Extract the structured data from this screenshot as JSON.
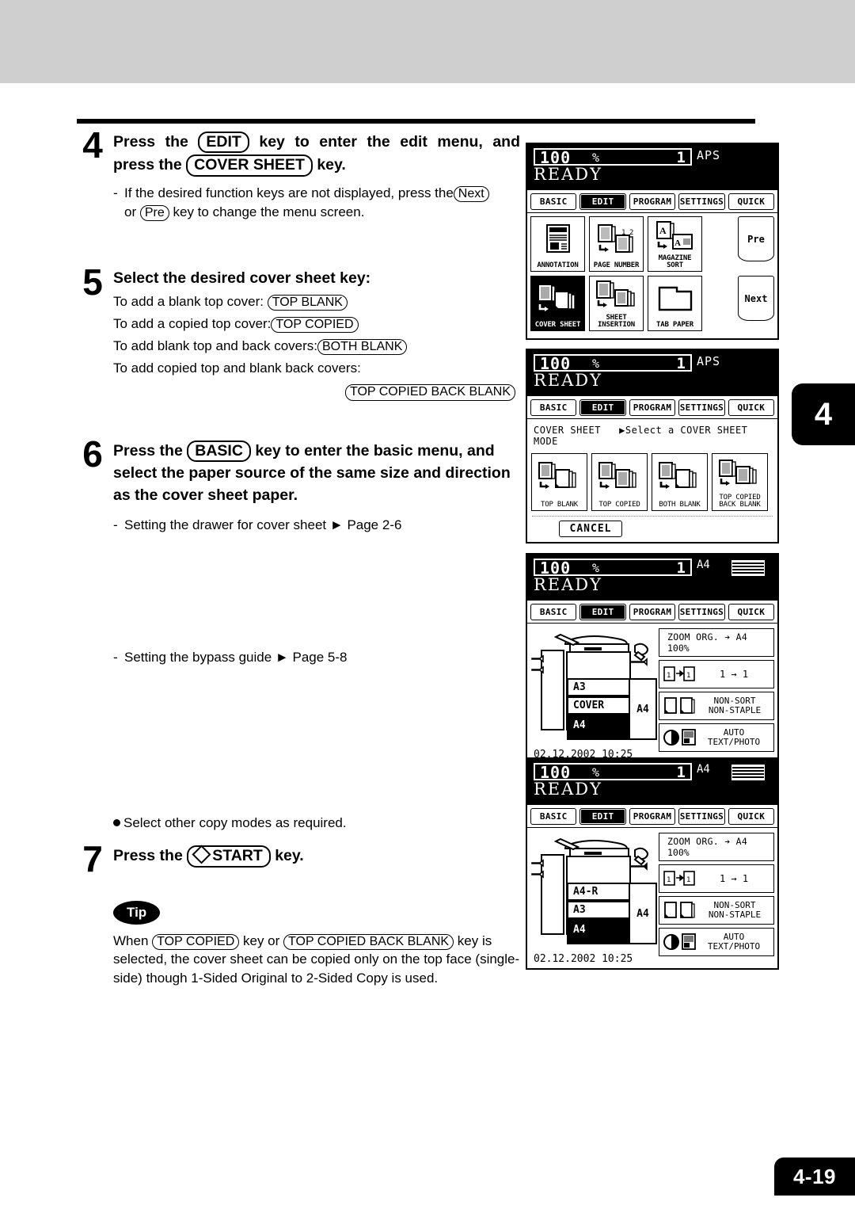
{
  "page": {
    "chapter_tab": "4",
    "page_number": "4-19"
  },
  "steps": {
    "step4": {
      "num": "4",
      "head_line1_a": "Press the",
      "head_key1": "EDIT",
      "head_line1_b": "key to enter the edit menu, and",
      "head_line2_a": "press the",
      "head_key2": "COVER SHEET",
      "head_line2_b": "key.",
      "sub_a": "If the desired function keys are not displayed, press the",
      "sub_key_next": "Next",
      "sub_b": "or",
      "sub_key_pre": "Pre",
      "sub_c": "key to change the menu screen."
    },
    "step5": {
      "num": "5",
      "head": "Select the desired cover sheet key:",
      "lines": [
        {
          "text": "To add a blank top cover:",
          "key": "TOP BLANK"
        },
        {
          "text": "To add a copied top cover:",
          "key": "TOP COPIED"
        },
        {
          "text": "To add blank top and back covers:",
          "key": "BOTH BLANK"
        },
        {
          "text": "To add copied top and blank back covers:",
          "key": ""
        }
      ],
      "last_key": "TOP COPIED BACK BLANK"
    },
    "step6": {
      "num": "6",
      "head_a": "Press the",
      "head_key": "BASIC",
      "head_b": "key to enter the basic menu, and",
      "head_line2": "select the paper source of the same size and direction",
      "head_line3": "as the cover sheet paper.",
      "sub1": "Setting the drawer for cover sheet",
      "sub1_ref": "Page 2-6",
      "sub2": "Setting the bypass guide",
      "sub2_ref": "Page 5-8"
    },
    "note_bullet": "Select other copy modes as required.",
    "step7": {
      "num": "7",
      "head_a": "Press the",
      "head_key": "START",
      "head_b": "key."
    },
    "tip": {
      "badge": "Tip",
      "t1": "When",
      "key1": "TOP COPIED",
      "t2": "key or",
      "key2": "TOP COPIED BACK BLANK",
      "t3": "key  is selected, the cover sheet can be copied only on the top face (single-side) though 1-Sided Original to 2-Sided Copy is used."
    }
  },
  "lcd_common": {
    "zoom": "100",
    "percent": "%",
    "copies": "1",
    "ready": "READY",
    "tabs": [
      "BASIC",
      "EDIT",
      "PROGRAM",
      "SETTINGS",
      "QUICK"
    ],
    "selected_tab": "EDIT"
  },
  "lcd1": {
    "status_right": "APS",
    "row1": [
      {
        "label": "ANNOTATION",
        "icon": "annotation-icon",
        "selected": false
      },
      {
        "label": "PAGE NUMBER",
        "icon": "page-number-icon",
        "selected": false
      },
      {
        "label": "MAGAZINE SORT",
        "icon": "magazine-sort-icon",
        "selected": false
      }
    ],
    "row2": [
      {
        "label": "COVER SHEET",
        "icon": "cover-sheet-icon",
        "selected": true
      },
      {
        "label": "SHEET INSERTION",
        "icon": "sheet-insertion-icon",
        "selected": false
      },
      {
        "label": "TAB PAPER",
        "icon": "tab-paper-icon",
        "selected": false
      }
    ],
    "nav_prev": "Pre",
    "nav_next": "Next"
  },
  "lcd2": {
    "status_right": "APS",
    "mode_title": "COVER SHEET",
    "mode_prompt": "Select a COVER SHEET MODE",
    "buttons": [
      {
        "label": "TOP BLANK",
        "icon": "top-blank-icon"
      },
      {
        "label": "TOP COPIED",
        "icon": "top-copied-icon"
      },
      {
        "label": "BOTH BLANK",
        "icon": "both-blank-icon"
      },
      {
        "label": "TOP COPIED BACK BLANK",
        "icon": "top-copied-back-blank-icon"
      }
    ],
    "cancel": "CANCEL"
  },
  "lcd3": {
    "status_right": "A4",
    "drawers": [
      {
        "label": "A3",
        "selected": false
      },
      {
        "label": "COVER",
        "selected": false
      },
      {
        "label": "A4",
        "selected": true
      }
    ],
    "bypass_label": "A4",
    "datetime": "02.12.2002 10:25",
    "zoom_btn_label": "ZOOM  ORG. ➔ A4",
    "zoom_btn_value": "100%",
    "duplex_label": "1 → 1",
    "finish_label_1": "NON-SORT",
    "finish_label_2": "NON-STAPLE",
    "exposure_label_1": "AUTO",
    "exposure_label_2": "TEXT/PHOTO"
  },
  "lcd4": {
    "status_right": "A4",
    "drawers": [
      {
        "label": "A4-R",
        "selected": false
      },
      {
        "label": "A3",
        "selected": false
      },
      {
        "label": "A4",
        "selected": true
      }
    ],
    "bypass_label": "A4",
    "datetime": "02.12.2002 10:25",
    "zoom_btn_label": "ZOOM  ORG. ➔ A4",
    "zoom_btn_value": "100%",
    "duplex_label": "1 → 1",
    "finish_label_1": "NON-SORT",
    "finish_label_2": "NON-STAPLE",
    "exposure_label_1": "AUTO",
    "exposure_label_2": "TEXT/PHOTO"
  }
}
